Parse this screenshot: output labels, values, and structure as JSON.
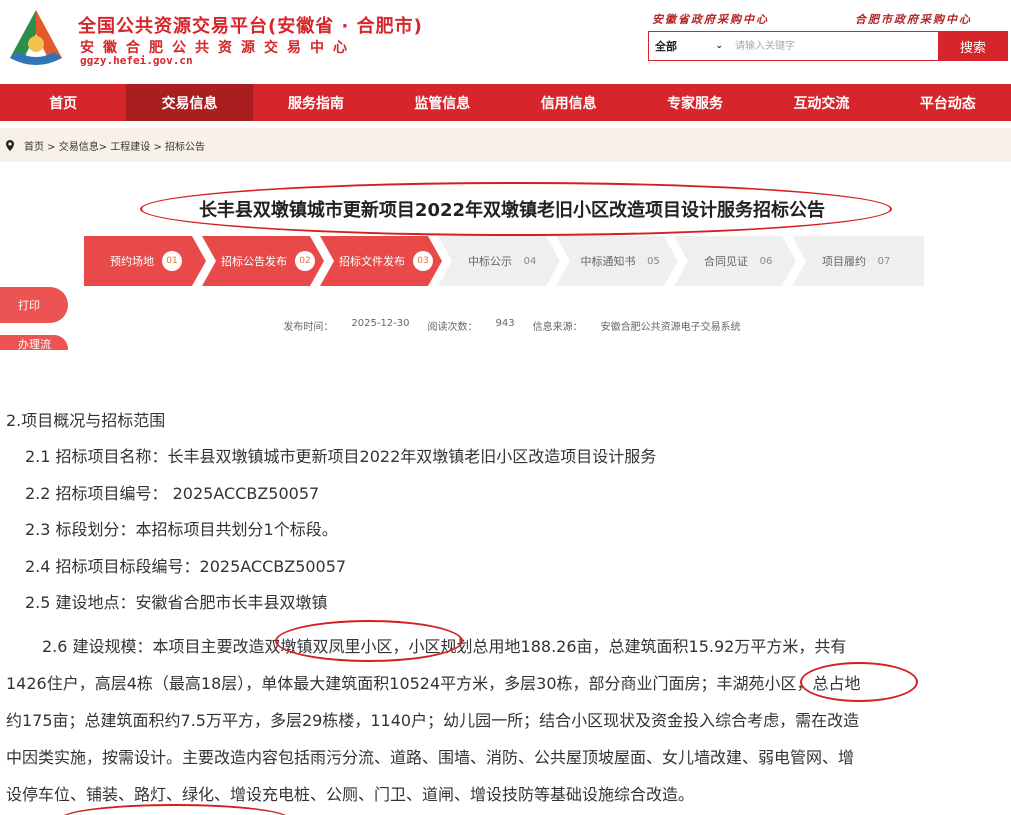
{
  "header": {
    "title": "全国公共资源交易平台(安徽省 · 合肥市)",
    "subtitle": "安徽合肥公共资源交易中心",
    "url": "ggzy.hefei.gov.cn",
    "top_link_1": "安徽省政府采购中心",
    "top_link_2": "合肥市政府采购中心",
    "search_scope": "全部",
    "search_placeholder": "请输入关键字",
    "search_button": "搜索"
  },
  "nav": [
    "首页",
    "交易信息",
    "服务指南",
    "监管信息",
    "信用信息",
    "专家服务",
    "互动交流",
    "平台动态"
  ],
  "nav_active": 1,
  "breadcrumb": "首页 > 交易信息> 工程建设 > 招标公告",
  "notice": {
    "title": "长丰县双墩镇城市更新项目2022年双墩镇老旧小区改造项目设计服务招标公告",
    "steps": [
      {
        "label": "预约场地",
        "num": "01",
        "state": "done"
      },
      {
        "label": "招标公告发布",
        "num": "02",
        "state": "done"
      },
      {
        "label": "招标文件发布",
        "num": "03",
        "state": "done"
      },
      {
        "label": "中标公示",
        "num": "04",
        "state": "todo"
      },
      {
        "label": "中标通知书",
        "num": "05",
        "state": "todo"
      },
      {
        "label": "合同见证",
        "num": "06",
        "state": "todo"
      },
      {
        "label": "项目履约",
        "num": "07",
        "state": "todo"
      }
    ],
    "meta": {
      "publish_label": "发布时间：",
      "publish_date": "2025-12-30",
      "views_label": "阅读次数：",
      "views": "943",
      "source_label": "信息来源：",
      "source": "安徽合肥公共资源电子交易系统"
    },
    "side_buttons": [
      "打印",
      "办理流"
    ]
  },
  "body": {
    "section": "2.项目概况与招标范围",
    "items": [
      "2.1 招标项目名称：长丰县双墩镇城市更新项目2022年双墩镇老旧小区改造项目设计服务",
      "2.2 招标项目编号： 2025ACCBZ50057",
      "2.3 标段划分：本招标项目共划分1个标段。",
      "2.4 招标项目标段编号：2025ACCBZ50057",
      "2.5 建设地点：安徽省合肥市长丰县双墩镇"
    ],
    "scale_lines": [
      "2.6 建设规模：本项目主要改造双墩镇双凤里小区，小区规划总用地188.26亩，总建筑面积15.92万平方米，共有",
      "1426住户，高层4栋（最高18层），单体最大建筑面积10524平方米，多层30栋，部分商业门面房；丰湖苑小区，总占地",
      "约175亩；总建筑面积约7.5万平方，多层29栋楼，1140户；幼儿园一所；结合小区现状及资金投入综合考虑，需在改造",
      "中因类实施，按需设计。主要改造内容包括雨污分流、道路、围墙、消防、公共屋顶坡屋面、女儿墙改建、弱电管网、增",
      "设停车位、铺装、路灯、绿化、增设充电桩、公厕、门卫、道闸、增设技防等基础设施综合改造。"
    ]
  },
  "colors": {
    "brand_red": "#d6262b",
    "nav_active": "#a81e21",
    "step_done": "#e84a4a",
    "step_todo": "#efefef",
    "annotation_red": "#d41f1f"
  }
}
